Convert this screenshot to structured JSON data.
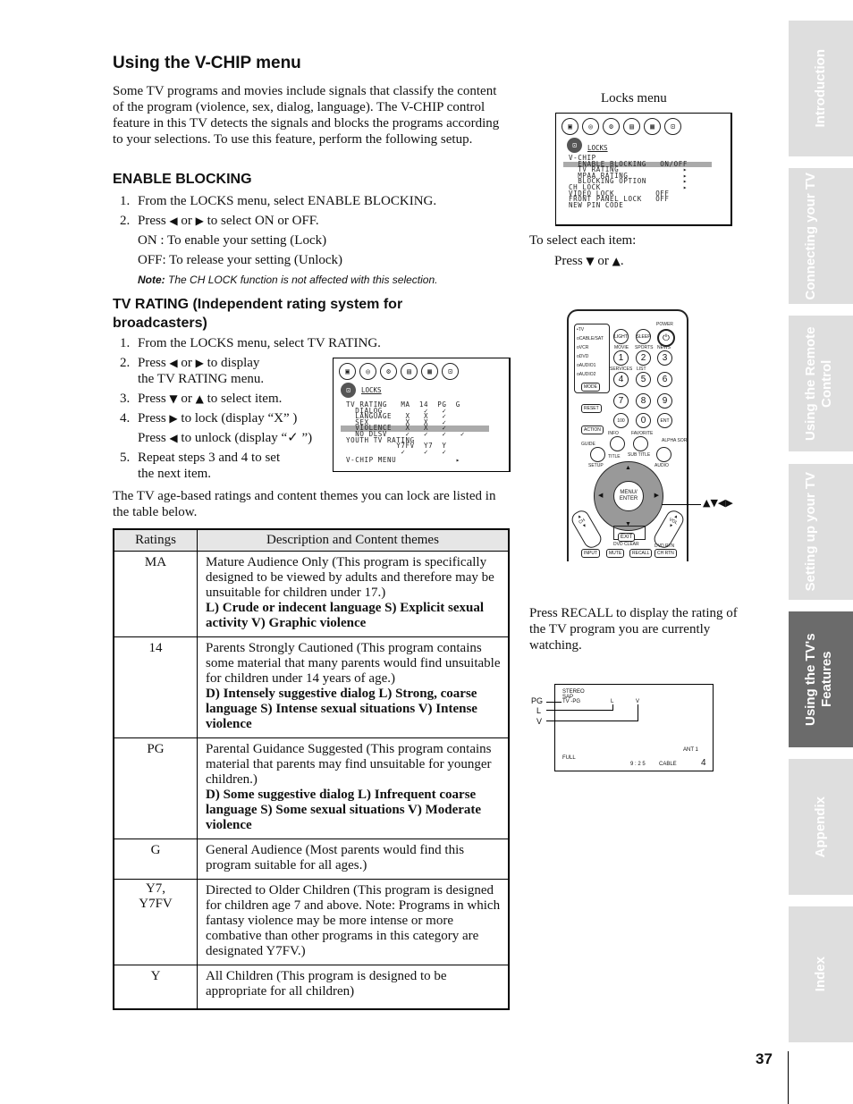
{
  "page": {
    "title": "Using the V-CHIP menu",
    "intro": "Some TV programs and movies include signals that classify the content of the program (violence, sex, dialog, language). The V-CHIP control feature in this TV detects the signals and blocks the programs according to your selections. To use this feature, perform the following setup.",
    "page_number": "37"
  },
  "enable_blocking": {
    "heading": "ENABLE BLOCKING",
    "steps": [
      {
        "num": "1.",
        "text": "From the LOCKS menu, select ENABLE BLOCKING."
      },
      {
        "num": "2.",
        "text_a": "Press",
        "text_b": "or",
        "text_c": "to select ON or OFF."
      }
    ],
    "on_text": "ON : To enable your setting (Lock)",
    "off_text": "OFF: To release your setting (Unlock)",
    "note_label": "Note:",
    "note_text": "The CH LOCK function is not affected with this selection."
  },
  "tv_rating": {
    "heading": "TV RATING (Independent rating system for broadcasters)",
    "step1": "From the LOCKS menu, select TV RATING.",
    "step2a": "Press",
    "step2b": "or",
    "step2c": "to display",
    "step2d": "the TV RATING menu.",
    "step3a": "Press",
    "step3b": "or",
    "step3c": "to select item.",
    "step4a": "Press",
    "step4b": "to lock (display “X” )",
    "step4c": "Press",
    "step4d": "to unlock (display “✓ ”)",
    "step5a": "Repeat steps 3 and 4 to set",
    "step5b": "the next item.",
    "table_intro": "The TV age-based ratings and content themes you can lock are listed in the table below."
  },
  "arrows": {
    "left": "◀",
    "right": "▶",
    "up": "▲",
    "down": "▼"
  },
  "ratings_table": {
    "headers": [
      "Ratings",
      "Description and Content themes"
    ],
    "rows": [
      {
        "rating": "MA",
        "desc": "Mature Audience Only (This program is specifically designed to be viewed by adults and therefore may be unsuitable for children under 17.)",
        "themes": "L) Crude or indecent language  S) Explicit sexual activity V) Graphic violence"
      },
      {
        "rating": "14",
        "desc": "Parents Strongly Cautioned (This program contains some material that many parents would find unsuitable for children under 14 years of age.)",
        "themes": "D) Intensely suggestive dialog  L) Strong, coarse language S) Intense sexual situations  V) Intense violence"
      },
      {
        "rating": "PG",
        "desc": "Parental Guidance Suggested (This program contains material that parents may find unsuitable for younger children.)",
        "themes": "D) Some suggestive dialog  L) Infrequent coarse language  S) Some sexual situations  V) Moderate violence"
      },
      {
        "rating": "G",
        "desc": "General Audience (Most parents would find this program suitable for all ages.)",
        "themes": ""
      },
      {
        "rating": "Y7, Y7FV",
        "desc": "Directed to Older Children (This program is designed for children age 7 and above. Note: Programs in which fantasy violence may be more intense or more combative than other programs in this category are designated Y7FV.)",
        "themes": ""
      },
      {
        "rating": "Y",
        "desc": "All Children (This program is designed to be appropriate for all children)",
        "themes": ""
      }
    ]
  },
  "locks_menu": {
    "caption": "Locks menu",
    "title": "LOCKS",
    "lines": [
      "V-CHIP",
      "  ENABLE BLOCKING   ON/OFF",
      "  TV RATING              ▸",
      "  MPAA RATING            ▸",
      "  BLOCKING OPTION        ▸",
      "CH LOCK                  ▸",
      "VIDEO LOCK         OFF",
      "FRONT PANEL LOCK   OFF",
      "NEW PIN CODE"
    ],
    "select_caption": "To select each item:",
    "select_press": "Press",
    "select_or": "or",
    "select_end": "."
  },
  "tv_rating_menu": {
    "title": "LOCKS",
    "lines": [
      "TV RATING   MA  14  PG  G",
      "  DIALOG         ✓   ✓",
      "  LANGUAGE   X   X   ✓",
      "  SEX        X   X   ✓",
      "  VIOLENCE   X   X   ✓",
      "  NO DLSV    ✓   ✓   ✓   ✓",
      "YOUTH TV RATING",
      "           Y7FV  Y7  Y",
      "            ✓    ✓   ✓",
      "V-CHIP MENU             ▸"
    ]
  },
  "remote": {
    "modes": [
      "•TV",
      "oCABLE/SAT",
      "oVCR",
      "oDVD",
      "oAUDIO1",
      "oAUDIO2"
    ],
    "mode_btn": "MODE",
    "light": "LIGHT",
    "sleep": "SLEEP",
    "power": "POWER",
    "labels_row1": [
      "MOVIE",
      "SPORTS",
      "NEWS"
    ],
    "labels_row2": [
      "SERVICES",
      "LIST"
    ],
    "digits": [
      "1",
      "2",
      "3",
      "4",
      "5",
      "6",
      "7",
      "8",
      "9",
      "100",
      "0",
      "ENT"
    ],
    "reset": "RESET",
    "action": "ACTION",
    "info": "INFO",
    "favorite": "FAVORITE",
    "guide": "GUIDE",
    "alpha_sort": "ALPHA SORT",
    "setup": "SETUP",
    "title": "TITLE",
    "subtitle": "SUB TITLE",
    "audio": "AUDIO",
    "menu_enter": "MENU/ ENTER",
    "ch": "CH",
    "vol": "VOL",
    "exit": "EXIT",
    "dvd_clear": "DVD CLEAR",
    "input": "INPUT",
    "mute": "MUTE",
    "recall": "RECALL",
    "dvd_rtn": "DVD RTN",
    "ch_rtn": "CH RTN",
    "callout": "▲▼◀▶"
  },
  "recall": {
    "text": "Press RECALL to display the rating of the TV program you are currently watching.",
    "screen": {
      "stereo": "STEREO",
      "sap": "SAP",
      "rating": "TV -PG",
      "l": "L",
      "v": "V",
      "ant": "ANT   1",
      "full": "FULL",
      "time": "9 : 2 5",
      "cable": "CABLE",
      "channel": "4"
    },
    "callouts": [
      "PG",
      "L",
      "V"
    ]
  },
  "side_tabs": [
    {
      "label": "Introduction",
      "active": false
    },
    {
      "label": "Connecting your TV",
      "active": false
    },
    {
      "label": "Using the Remote Control",
      "active": false
    },
    {
      "label": "Setting up your TV",
      "active": false
    },
    {
      "label": "Using the TV's Features",
      "active": true
    },
    {
      "label": "Appendix",
      "active": false
    },
    {
      "label": "Index",
      "active": false
    }
  ]
}
